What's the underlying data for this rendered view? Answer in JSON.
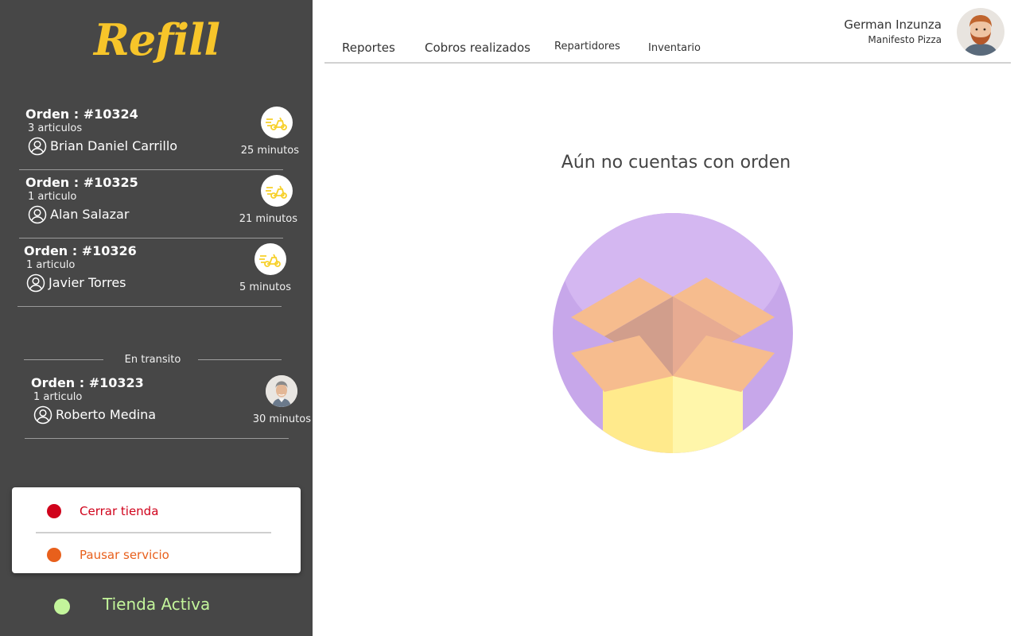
{
  "brand": {
    "logo_text": "Refill",
    "logo_color": "#f7c52a"
  },
  "sidebar": {
    "orders": [
      {
        "title": "Orden : #10324",
        "items": "3 articulos",
        "customer": "Brian Daniel Carrillo",
        "time": "25 minutos",
        "icon": "scooter-icon"
      },
      {
        "title": "Orden : #10325",
        "items": "1 articulo",
        "customer": "Alan Salazar",
        "time": "21 minutos",
        "icon": "scooter-icon"
      },
      {
        "title": "Orden : #10326",
        "items": "1 articulo",
        "customer": "Javier Torres",
        "time": "5 minutos",
        "icon": "scooter-icon"
      }
    ],
    "transit_label": "En transito",
    "transit_orders": [
      {
        "title": "Orden : #10323",
        "items": "1 articulo",
        "customer": "Roberto Medina",
        "time": "30 minutos",
        "icon": "driver-avatar"
      }
    ]
  },
  "store_panel": {
    "close_label": "Cerrar tienda",
    "close_color": "#d0021b",
    "pause_label": "Pausar servicio",
    "pause_color": "#e8601c"
  },
  "status": {
    "label": "Tienda Activa",
    "color": "#c3f59b"
  },
  "nav": {
    "tabs": [
      {
        "label": "Reportes"
      },
      {
        "label": "Cobros realizados"
      },
      {
        "label": "Repartidores"
      },
      {
        "label": "Inventario"
      }
    ]
  },
  "user": {
    "name": "German Inzunza",
    "store": "Manifesto Pizza"
  },
  "main": {
    "empty_message": "Aún no cuentas con orden"
  },
  "colors": {
    "sidebar_bg": "#474747",
    "accent_yellow": "#f7c52a"
  }
}
